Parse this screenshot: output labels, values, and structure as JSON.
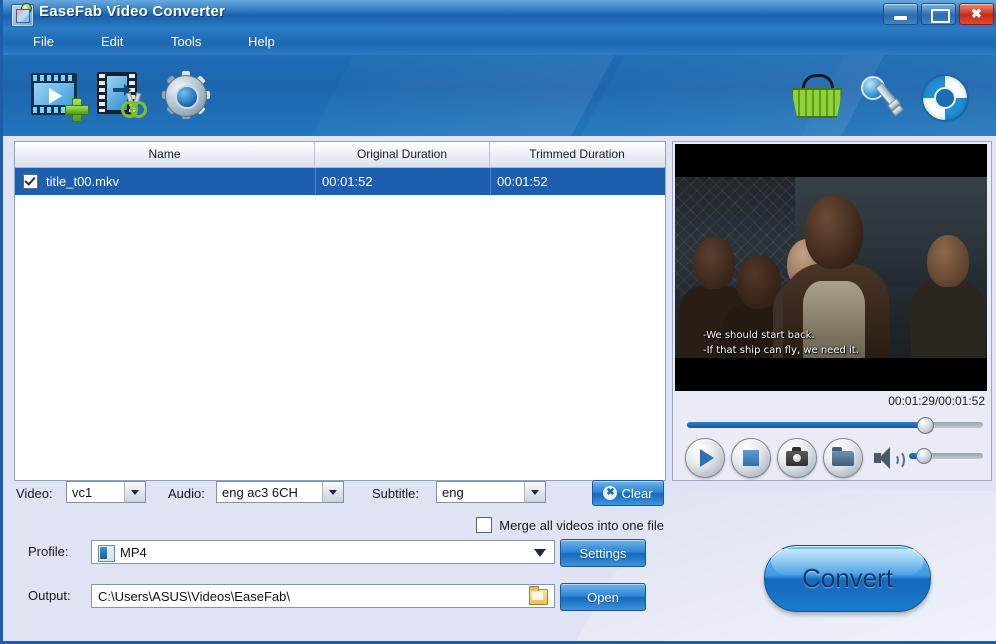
{
  "window": {
    "title": "EaseFab Video Converter",
    "buttons": {
      "minimize": "–",
      "maximize": "☐",
      "close": "✖"
    }
  },
  "menu": {
    "items": [
      {
        "label": "File"
      },
      {
        "label": "Edit"
      },
      {
        "label": "Tools"
      },
      {
        "label": "Help"
      }
    ]
  },
  "toolbar": {
    "left": [
      {
        "name": "add-video",
        "icon": "add-video-icon"
      },
      {
        "name": "edit-video",
        "icon": "film-scissors-icon"
      },
      {
        "name": "settings",
        "icon": "gear-icon"
      }
    ],
    "right": [
      {
        "name": "buy",
        "icon": "shopping-basket-icon"
      },
      {
        "name": "register",
        "icon": "key-icon"
      },
      {
        "name": "support",
        "icon": "lifebuoy-icon"
      }
    ]
  },
  "file_list": {
    "columns": [
      "Name",
      "Original Duration",
      "Trimmed Duration"
    ],
    "rows": [
      {
        "checked": true,
        "name": "title_t00.mkv",
        "original_duration": "00:01:52",
        "trimmed_duration": "00:01:52"
      }
    ]
  },
  "preview": {
    "subtitle_line1": "-We should start back.",
    "subtitle_line2": "-If that ship can fly, we need it.",
    "time": "00:01:29/00:01:52",
    "seek_percent": 80,
    "volume_percent": 18,
    "controls": [
      {
        "label": "play",
        "icon": "play-icon"
      },
      {
        "label": "stop",
        "icon": "stop-icon"
      },
      {
        "label": "snapshot",
        "icon": "camera-icon"
      },
      {
        "label": "open folder",
        "icon": "folder-icon"
      }
    ],
    "volume_icon": "speaker-icon"
  },
  "streams": {
    "video_label": "Video:",
    "video_value": "vc1",
    "audio_label": "Audio:",
    "audio_value": "eng ac3 6CH",
    "subtitle_label": "Subtitle:",
    "subtitle_value": "eng",
    "clear_label": "Clear",
    "clear_icon": "circle-x-icon"
  },
  "merge": {
    "label": "Merge all videos into one file",
    "checked": false
  },
  "output_settings": {
    "profile_label": "Profile:",
    "profile_value": "MP4",
    "profile_icon": "mp4-file-icon",
    "settings_label": "Settings",
    "output_label": "Output:",
    "output_value": "C:\\Users\\ASUS\\Videos\\EaseFab\\",
    "browse_icon": "folder-browse-icon",
    "open_label": "Open"
  },
  "convert": {
    "label": "Convert"
  },
  "colors": {
    "titlebar_blue": "#1e6cba",
    "toolbar_blue": "#1d66ae",
    "selection_blue": "#1b5fae",
    "panel_lavender": "#dfe3f3",
    "accent_button": "#1569bc"
  }
}
